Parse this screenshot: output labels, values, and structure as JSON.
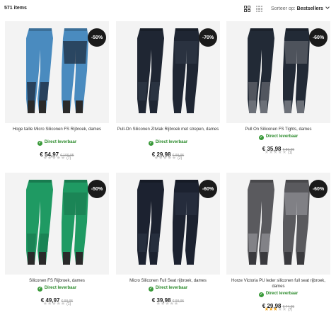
{
  "results": {
    "count_label": "571 items"
  },
  "sort": {
    "label": "Sorteer op:",
    "value": "Bestsellers"
  },
  "products": [
    {
      "name": "Hoge taille Micro Siliconen FS Rijbroek, dames",
      "stock": "Direct leverbaar",
      "price": "€ 54,97",
      "old_price": "€ 109,95",
      "discount": "-50%",
      "rating": 0,
      "reviews": "(7)",
      "color": "#4a8bbf",
      "seat": "#22344a",
      "sock": "#2a2a2a"
    },
    {
      "name": "Pull-On Siliconen Zitvlak Rijbroek met strepen, dames",
      "stock": "Direct leverbaar",
      "price": "€ 29,98",
      "old_price": "€ 99,95",
      "discount": "-70%",
      "rating": 0,
      "reviews": "(2)",
      "color": "#1f2633",
      "seat": "#2d3644",
      "sock": "#1f2633"
    },
    {
      "name": "Pull On Siliconen FS Tights, dames",
      "stock": "Direct leverbaar",
      "price": "€ 35,98",
      "old_price": "€ 89,95",
      "discount": "-60%",
      "rating": 0,
      "reviews": "(1)",
      "color": "#222a36",
      "seat": "#5a5e66",
      "sock": "#6c7078"
    },
    {
      "name": "Siliconen FS Rijbroek, dames",
      "stock": "Direct leverbaar",
      "price": "€ 49,97",
      "old_price": "€ 99,95",
      "discount": "-50%",
      "rating": 0,
      "reviews": "(1)",
      "color": "#1f9a63",
      "seat": "#1a7f52",
      "sock": "#2a2a2a"
    },
    {
      "name": "Micro Siliconen Full Seat rijbroek, dames",
      "stock": "Direct leverbaar",
      "price": "€ 39,98",
      "old_price": "€ 99,95",
      "discount": "-60%",
      "rating": 0,
      "reviews": "",
      "color": "#1c2230",
      "seat": "#283040",
      "sock": "#1c2230"
    },
    {
      "name": "Horze Victoria PU leder siliconen full seat rijbroek, dames",
      "stock": "Direct leverbaar",
      "price": "€ 29,98",
      "old_price": "€ 74,95",
      "discount": "-60%",
      "rating": 3,
      "reviews": "(7)",
      "color": "#5a5a5e",
      "seat": "#8a8a8e",
      "sock": "#3a3a3e"
    }
  ]
}
